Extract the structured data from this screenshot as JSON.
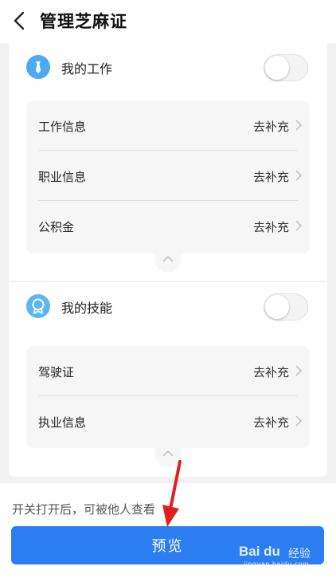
{
  "header": {
    "title": "管理芝麻证",
    "back_icon": "chevron-left-icon"
  },
  "sections": [
    {
      "title": "我的工作",
      "icon": "tie-icon",
      "icon_color": "#4ea9f5",
      "toggle_on": false,
      "rows": [
        {
          "label": "工作信息",
          "action": "去补充"
        },
        {
          "label": "职业信息",
          "action": "去补充"
        },
        {
          "label": "公积金",
          "action": "去补充"
        }
      ]
    },
    {
      "title": "我的技能",
      "icon": "medal-icon",
      "icon_color": "#5bb6f3",
      "toggle_on": false,
      "rows": [
        {
          "label": "驾驶证",
          "action": "去补充"
        },
        {
          "label": "执业信息",
          "action": "去补充"
        }
      ]
    }
  ],
  "footer": {
    "hint": "开关打开后，可被他人查看",
    "preview_label": "预览",
    "accent_color": "#2b7df1"
  },
  "watermark": {
    "brand": "Bai du",
    "suffix": "经验",
    "url": "jingyan.baidu.com"
  }
}
